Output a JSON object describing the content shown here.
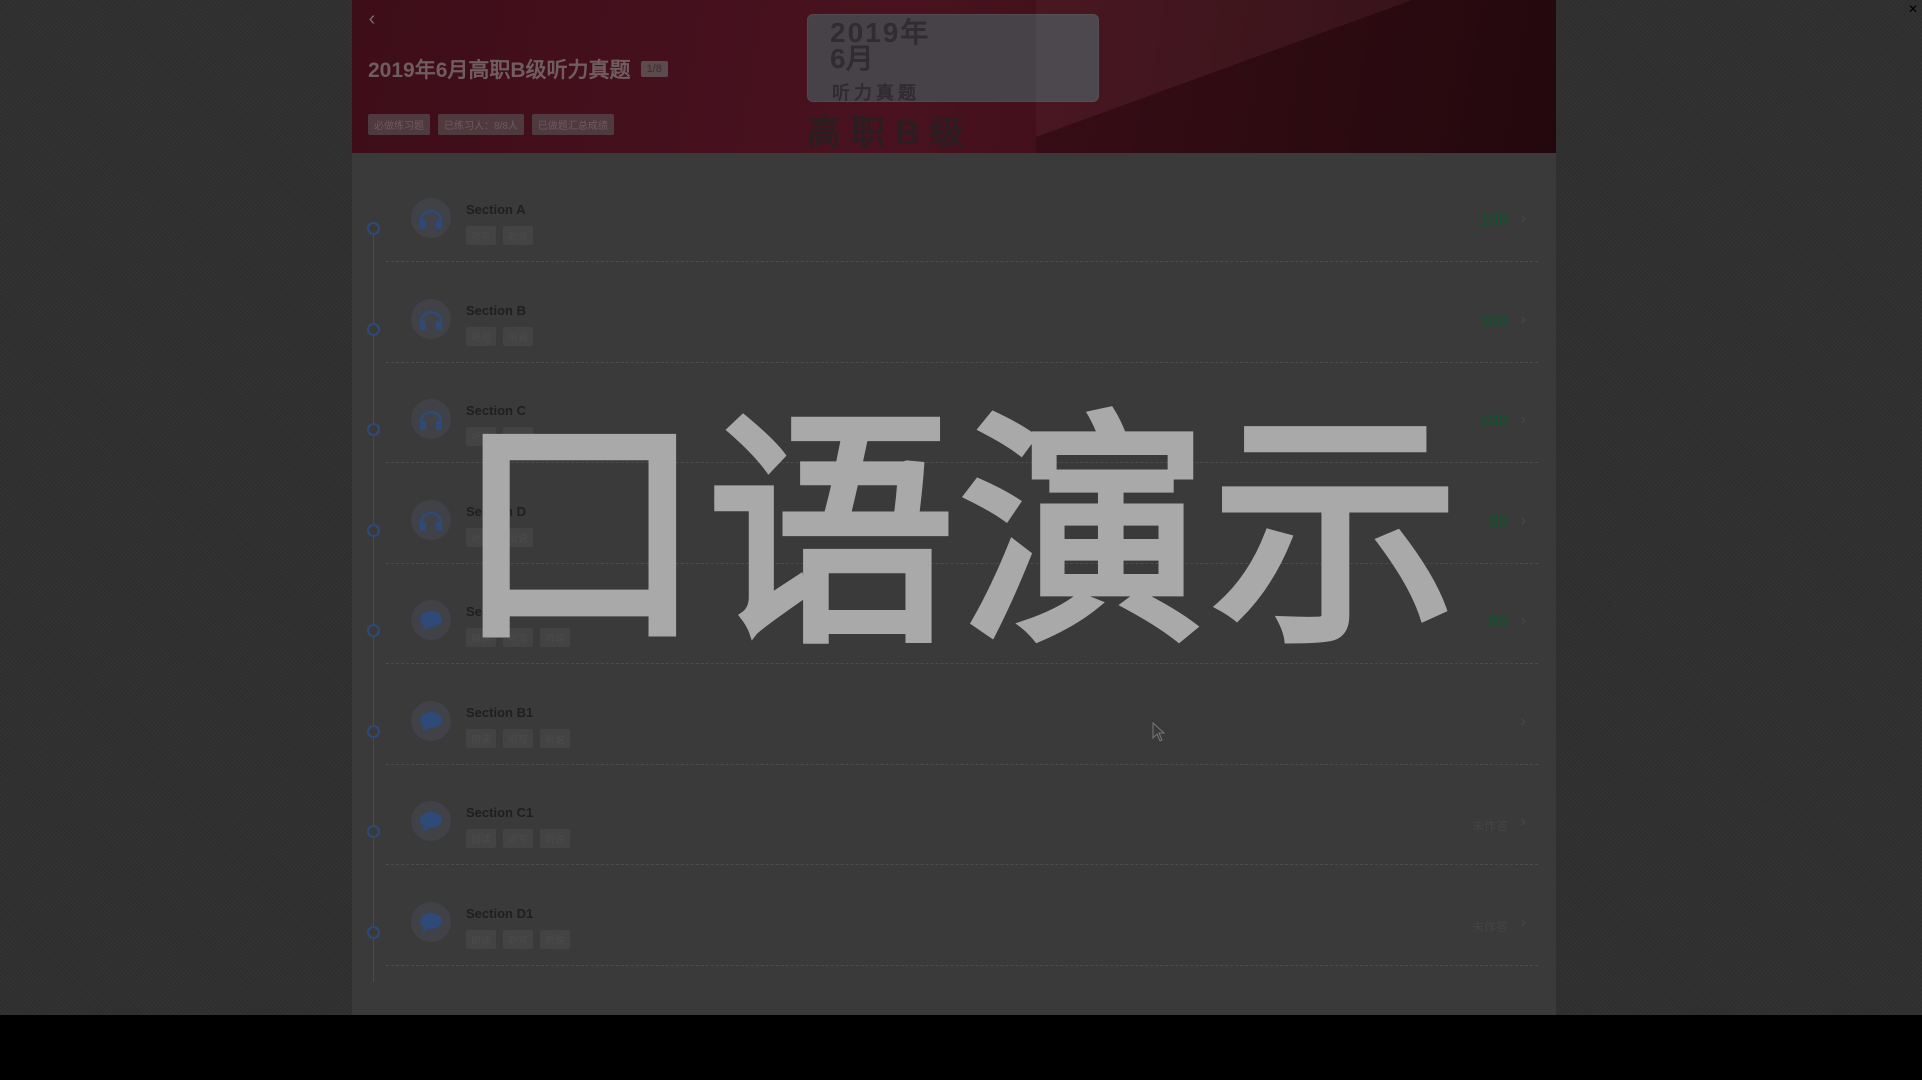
{
  "header": {
    "back_icon": "chevron-left-icon",
    "title": "2019年6月高职B级听力真题",
    "badge": "1/8",
    "tags": [
      "必做练习题",
      "已练习人：8/8人",
      "已做题汇总成绩"
    ]
  },
  "cover": {
    "year": "2019年",
    "month": "6月",
    "subtitle": "听力真题",
    "level": "高职B级"
  },
  "sections": [
    {
      "title": "Section A",
      "tags": [
        "听写",
        "听说"
      ],
      "score": "100",
      "icon": "headphones-icon"
    },
    {
      "title": "Section B",
      "tags": [
        "听写",
        "听说"
      ],
      "score": "100",
      "icon": "headphones-icon"
    },
    {
      "title": "Section C",
      "tags": [
        "听写",
        "听说"
      ],
      "score": "100",
      "icon": "headphones-icon"
    },
    {
      "title": "Section D",
      "tags": [
        "听写",
        "听说"
      ],
      "score": "80",
      "icon": "headphones-icon"
    },
    {
      "title": "Section A1",
      "tags": [
        "朗读",
        "听写",
        "听说"
      ],
      "score": "80",
      "icon": "chat-icon"
    },
    {
      "title": "Section B1",
      "tags": [
        "朗读",
        "听写",
        "听说"
      ],
      "score": "",
      "icon": "chat-icon"
    },
    {
      "title": "Section C1",
      "tags": [
        "朗读",
        "听写",
        "听说"
      ],
      "score": "未作答",
      "icon": "chat-icon"
    },
    {
      "title": "Section D1",
      "tags": [
        "朗读",
        "听写",
        "听说"
      ],
      "score": "未作答",
      "icon": "chat-icon"
    }
  ],
  "overlay": {
    "watermark": "口语演示"
  },
  "colors": {
    "banner": "#4a1220",
    "score": "#16502e",
    "timeline_dot": "#2d4a7a"
  }
}
